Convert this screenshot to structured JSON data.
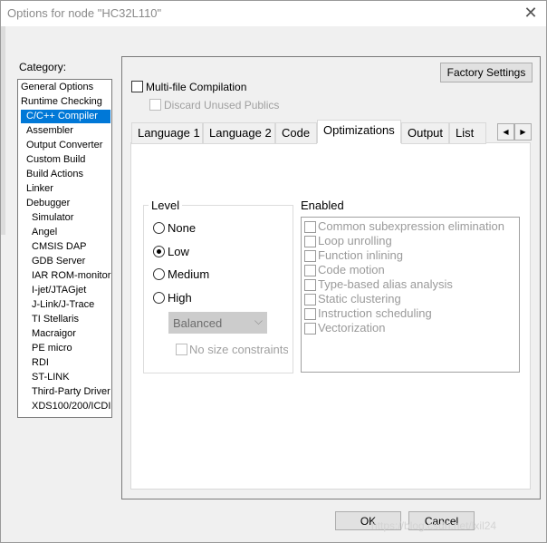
{
  "window": {
    "title": "Options for node \"HC32L110\"",
    "close_glyph": "✕"
  },
  "category": {
    "label": "Category:",
    "items": [
      "General Options",
      "Runtime Checking",
      "C/C++ Compiler",
      "Assembler",
      "Output Converter",
      "Custom Build",
      "Build Actions",
      "Linker",
      "Debugger",
      "Simulator",
      "Angel",
      "CMSIS DAP",
      "GDB Server",
      "IAR ROM-monitor",
      "I-jet/JTAGjet",
      "J-Link/J-Trace",
      "TI Stellaris",
      "Macraigor",
      "PE micro",
      "RDI",
      "ST-LINK",
      "Third-Party Driver",
      "XDS100/200/ICDI"
    ],
    "selected_index": 2
  },
  "factory_settings": "Factory Settings",
  "multi_file": {
    "label": "Multi-file Compilation",
    "checked": false
  },
  "discard_unused": {
    "label": "Discard Unused Publics",
    "checked": false,
    "disabled": true
  },
  "tabs": {
    "items": [
      "Language 1",
      "Language 2",
      "Code",
      "Optimizations",
      "Output",
      "List"
    ],
    "active_index": 3,
    "scroll_left": "◀",
    "scroll_right": "▶"
  },
  "level": {
    "title": "Level",
    "options": [
      "None",
      "Low",
      "Medium",
      "High"
    ],
    "selected": "Low",
    "combo_value": "Balanced",
    "combo_arrow": "⌵",
    "no_size_label": "No size constraints",
    "no_size_checked": false
  },
  "enabled": {
    "title": "Enabled",
    "items": [
      "Common subexpression elimination",
      "Loop unrolling",
      "Function inlining",
      "Code motion",
      "Type-based alias analysis",
      "Static clustering",
      "Instruction scheduling",
      "Vectorization"
    ]
  },
  "buttons": {
    "ok": "OK",
    "cancel": "Cancel"
  },
  "watermark": "https://blog.csdn.net/lxil24"
}
